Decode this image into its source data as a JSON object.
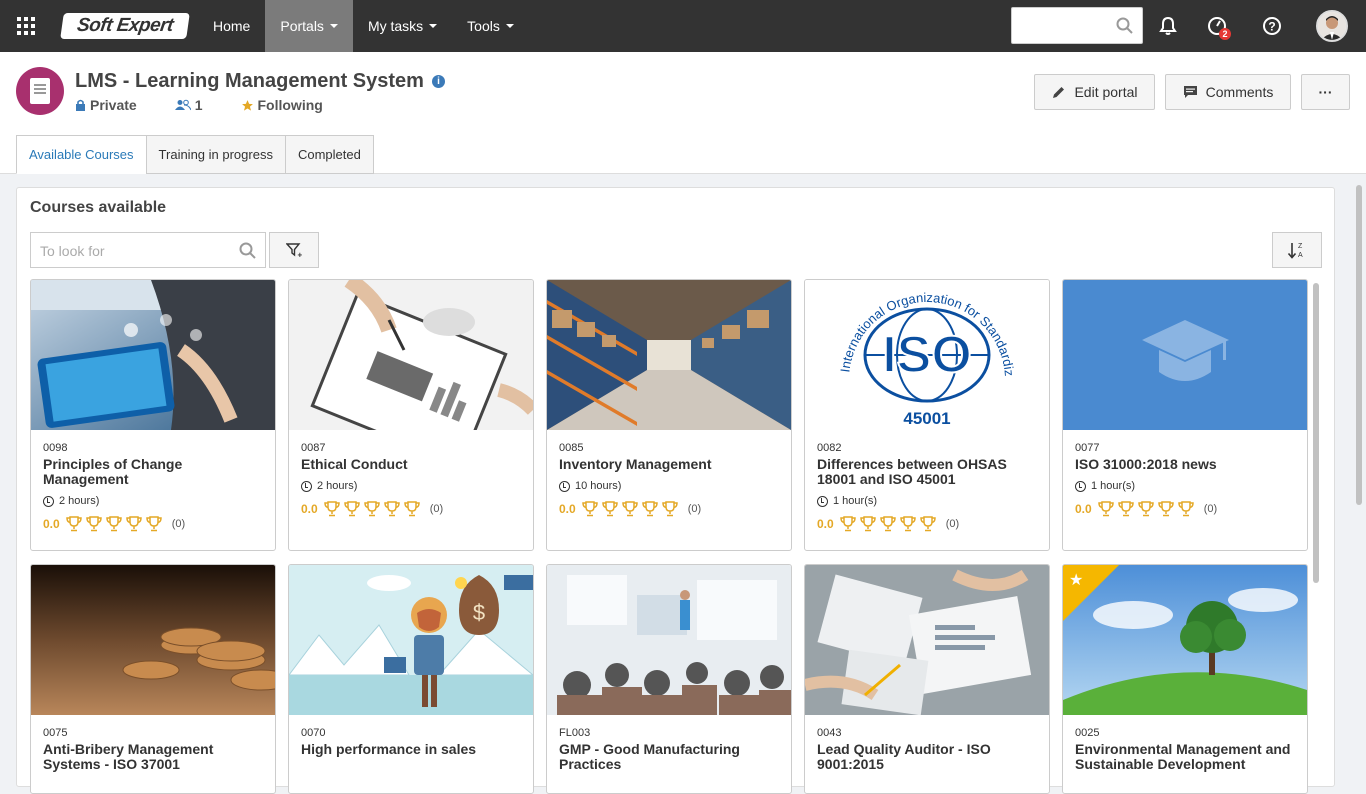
{
  "topbar": {
    "logo_text": "Soft Expert",
    "nav": [
      {
        "label": "Home",
        "has_caret": false,
        "active": false
      },
      {
        "label": "Portals",
        "has_caret": true,
        "active": true
      },
      {
        "label": "My tasks",
        "has_caret": true,
        "active": false
      },
      {
        "label": "Tools",
        "has_caret": true,
        "active": false
      }
    ],
    "search_placeholder": "",
    "notifications_badge": "2"
  },
  "portal": {
    "title": "LMS - Learning Management System",
    "privacy": "Private",
    "members": "1",
    "following": "Following",
    "edit_label": "Edit portal",
    "comments_label": "Comments",
    "more_label": "···"
  },
  "tabs": [
    "Available Courses",
    "Training in progress",
    "Completed"
  ],
  "panel": {
    "title": "Courses available",
    "search_placeholder": "To look for"
  },
  "courses": [
    {
      "code": "0098",
      "title": "Principles of Change Management",
      "hours": "2 hours)",
      "score": "0.0",
      "count": "(0)",
      "thumb": "tech"
    },
    {
      "code": "0087",
      "title": "Ethical Conduct",
      "hours": "2 hours)",
      "score": "0.0",
      "count": "(0)",
      "thumb": "ethics"
    },
    {
      "code": "0085",
      "title": "Inventory Management",
      "hours": "10 hours)",
      "score": "0.0",
      "count": "(0)",
      "thumb": "warehouse"
    },
    {
      "code": "0082",
      "title": "Differences between OHSAS 18001 and ISO 45001",
      "hours": "1 hour(s)",
      "score": "0.0",
      "count": "(0)",
      "thumb": "iso"
    },
    {
      "code": "0077",
      "title": "ISO 31000:2018 news",
      "hours": "1 hour(s)",
      "score": "0.0",
      "count": "(0)",
      "thumb": "cap"
    },
    {
      "code": "0075",
      "title": "Anti-Bribery Management Systems - ISO 37001",
      "thumb": "coins"
    },
    {
      "code": "0070",
      "title": "High performance in sales",
      "thumb": "sales"
    },
    {
      "code": "FL003",
      "title": "GMP - Good Manufacturing Practices",
      "thumb": "class"
    },
    {
      "code": "0043",
      "title": "Lead Quality Auditor - ISO 9001:2015",
      "thumb": "audit"
    },
    {
      "code": "0025",
      "title": "Environmental Management and Sustainable Development",
      "thumb": "tree",
      "favorite": true
    }
  ],
  "iso_logo": {
    "text": "ISO",
    "arc": "International Organization for Standardization",
    "number": "45001"
  },
  "colors": {
    "accent": "#2a7ab8",
    "topbar": "#333333",
    "trophy": "#e4a826",
    "portal_icon": "#a8306e"
  }
}
